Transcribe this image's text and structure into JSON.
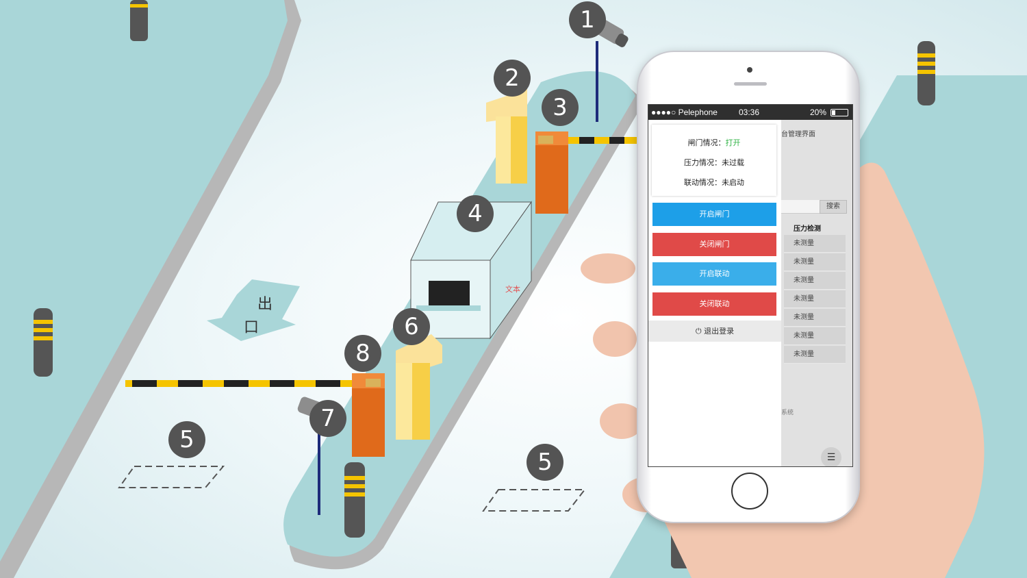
{
  "scene": {
    "markers": [
      "1",
      "2",
      "3",
      "4",
      "5",
      "5",
      "6",
      "7",
      "8"
    ],
    "exit_chars": [
      "出",
      "口"
    ],
    "booth_text": "文本"
  },
  "phone": {
    "status_bar": {
      "carrier": "●●●●○ Pelephone",
      "time": "03:36",
      "battery": "20%"
    },
    "status_card": {
      "gate_label": "闸门情况：",
      "gate_value": "打开",
      "pressure_label": "压力情况：",
      "pressure_value": "未过载",
      "linkage_label": "联动情况：",
      "linkage_value": "未启动"
    },
    "buttons": {
      "open_gate": "开启闸门",
      "close_gate": "关闭闸门",
      "open_linkage": "开启联动",
      "close_linkage": "关闭联动"
    },
    "logout": "⏻ 退出登录",
    "background_page": {
      "title": "台管理界面",
      "search_button": "搜索",
      "column_header": "压力检测",
      "cells": [
        "未测量",
        "未测量",
        "未测量",
        "未测量",
        "未测量",
        "未测量",
        "未测量"
      ],
      "footer": "系统",
      "menu_icon": "☰"
    }
  },
  "colors": {
    "blue_button": "#1d9fe8",
    "red_button": "#e04a48",
    "road": "#a9d6d8",
    "marker": "#545454"
  }
}
